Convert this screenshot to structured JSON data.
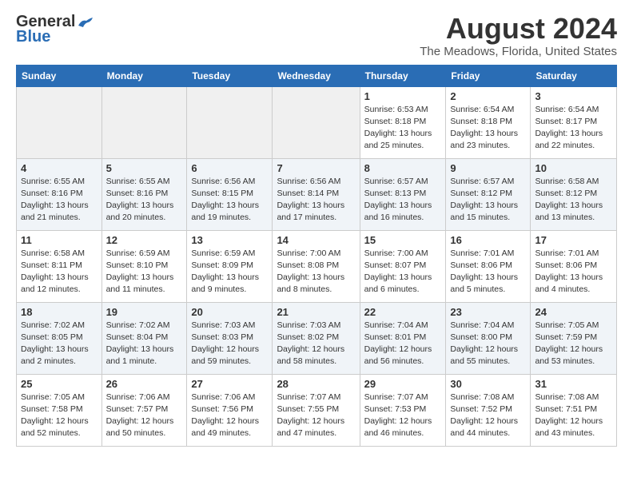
{
  "logo": {
    "line1": "General",
    "line2": "Blue"
  },
  "title": "August 2024",
  "location": "The Meadows, Florida, United States",
  "headers": [
    "Sunday",
    "Monday",
    "Tuesday",
    "Wednesday",
    "Thursday",
    "Friday",
    "Saturday"
  ],
  "weeks": [
    [
      {
        "day": "",
        "info": ""
      },
      {
        "day": "",
        "info": ""
      },
      {
        "day": "",
        "info": ""
      },
      {
        "day": "",
        "info": ""
      },
      {
        "day": "1",
        "info": "Sunrise: 6:53 AM\nSunset: 8:18 PM\nDaylight: 13 hours\nand 25 minutes."
      },
      {
        "day": "2",
        "info": "Sunrise: 6:54 AM\nSunset: 8:18 PM\nDaylight: 13 hours\nand 23 minutes."
      },
      {
        "day": "3",
        "info": "Sunrise: 6:54 AM\nSunset: 8:17 PM\nDaylight: 13 hours\nand 22 minutes."
      }
    ],
    [
      {
        "day": "4",
        "info": "Sunrise: 6:55 AM\nSunset: 8:16 PM\nDaylight: 13 hours\nand 21 minutes."
      },
      {
        "day": "5",
        "info": "Sunrise: 6:55 AM\nSunset: 8:16 PM\nDaylight: 13 hours\nand 20 minutes."
      },
      {
        "day": "6",
        "info": "Sunrise: 6:56 AM\nSunset: 8:15 PM\nDaylight: 13 hours\nand 19 minutes."
      },
      {
        "day": "7",
        "info": "Sunrise: 6:56 AM\nSunset: 8:14 PM\nDaylight: 13 hours\nand 17 minutes."
      },
      {
        "day": "8",
        "info": "Sunrise: 6:57 AM\nSunset: 8:13 PM\nDaylight: 13 hours\nand 16 minutes."
      },
      {
        "day": "9",
        "info": "Sunrise: 6:57 AM\nSunset: 8:12 PM\nDaylight: 13 hours\nand 15 minutes."
      },
      {
        "day": "10",
        "info": "Sunrise: 6:58 AM\nSunset: 8:12 PM\nDaylight: 13 hours\nand 13 minutes."
      }
    ],
    [
      {
        "day": "11",
        "info": "Sunrise: 6:58 AM\nSunset: 8:11 PM\nDaylight: 13 hours\nand 12 minutes."
      },
      {
        "day": "12",
        "info": "Sunrise: 6:59 AM\nSunset: 8:10 PM\nDaylight: 13 hours\nand 11 minutes."
      },
      {
        "day": "13",
        "info": "Sunrise: 6:59 AM\nSunset: 8:09 PM\nDaylight: 13 hours\nand 9 minutes."
      },
      {
        "day": "14",
        "info": "Sunrise: 7:00 AM\nSunset: 8:08 PM\nDaylight: 13 hours\nand 8 minutes."
      },
      {
        "day": "15",
        "info": "Sunrise: 7:00 AM\nSunset: 8:07 PM\nDaylight: 13 hours\nand 6 minutes."
      },
      {
        "day": "16",
        "info": "Sunrise: 7:01 AM\nSunset: 8:06 PM\nDaylight: 13 hours\nand 5 minutes."
      },
      {
        "day": "17",
        "info": "Sunrise: 7:01 AM\nSunset: 8:06 PM\nDaylight: 13 hours\nand 4 minutes."
      }
    ],
    [
      {
        "day": "18",
        "info": "Sunrise: 7:02 AM\nSunset: 8:05 PM\nDaylight: 13 hours\nand 2 minutes."
      },
      {
        "day": "19",
        "info": "Sunrise: 7:02 AM\nSunset: 8:04 PM\nDaylight: 13 hours\nand 1 minute."
      },
      {
        "day": "20",
        "info": "Sunrise: 7:03 AM\nSunset: 8:03 PM\nDaylight: 12 hours\nand 59 minutes."
      },
      {
        "day": "21",
        "info": "Sunrise: 7:03 AM\nSunset: 8:02 PM\nDaylight: 12 hours\nand 58 minutes."
      },
      {
        "day": "22",
        "info": "Sunrise: 7:04 AM\nSunset: 8:01 PM\nDaylight: 12 hours\nand 56 minutes."
      },
      {
        "day": "23",
        "info": "Sunrise: 7:04 AM\nSunset: 8:00 PM\nDaylight: 12 hours\nand 55 minutes."
      },
      {
        "day": "24",
        "info": "Sunrise: 7:05 AM\nSunset: 7:59 PM\nDaylight: 12 hours\nand 53 minutes."
      }
    ],
    [
      {
        "day": "25",
        "info": "Sunrise: 7:05 AM\nSunset: 7:58 PM\nDaylight: 12 hours\nand 52 minutes."
      },
      {
        "day": "26",
        "info": "Sunrise: 7:06 AM\nSunset: 7:57 PM\nDaylight: 12 hours\nand 50 minutes."
      },
      {
        "day": "27",
        "info": "Sunrise: 7:06 AM\nSunset: 7:56 PM\nDaylight: 12 hours\nand 49 minutes."
      },
      {
        "day": "28",
        "info": "Sunrise: 7:07 AM\nSunset: 7:55 PM\nDaylight: 12 hours\nand 47 minutes."
      },
      {
        "day": "29",
        "info": "Sunrise: 7:07 AM\nSunset: 7:53 PM\nDaylight: 12 hours\nand 46 minutes."
      },
      {
        "day": "30",
        "info": "Sunrise: 7:08 AM\nSunset: 7:52 PM\nDaylight: 12 hours\nand 44 minutes."
      },
      {
        "day": "31",
        "info": "Sunrise: 7:08 AM\nSunset: 7:51 PM\nDaylight: 12 hours\nand 43 minutes."
      }
    ]
  ]
}
